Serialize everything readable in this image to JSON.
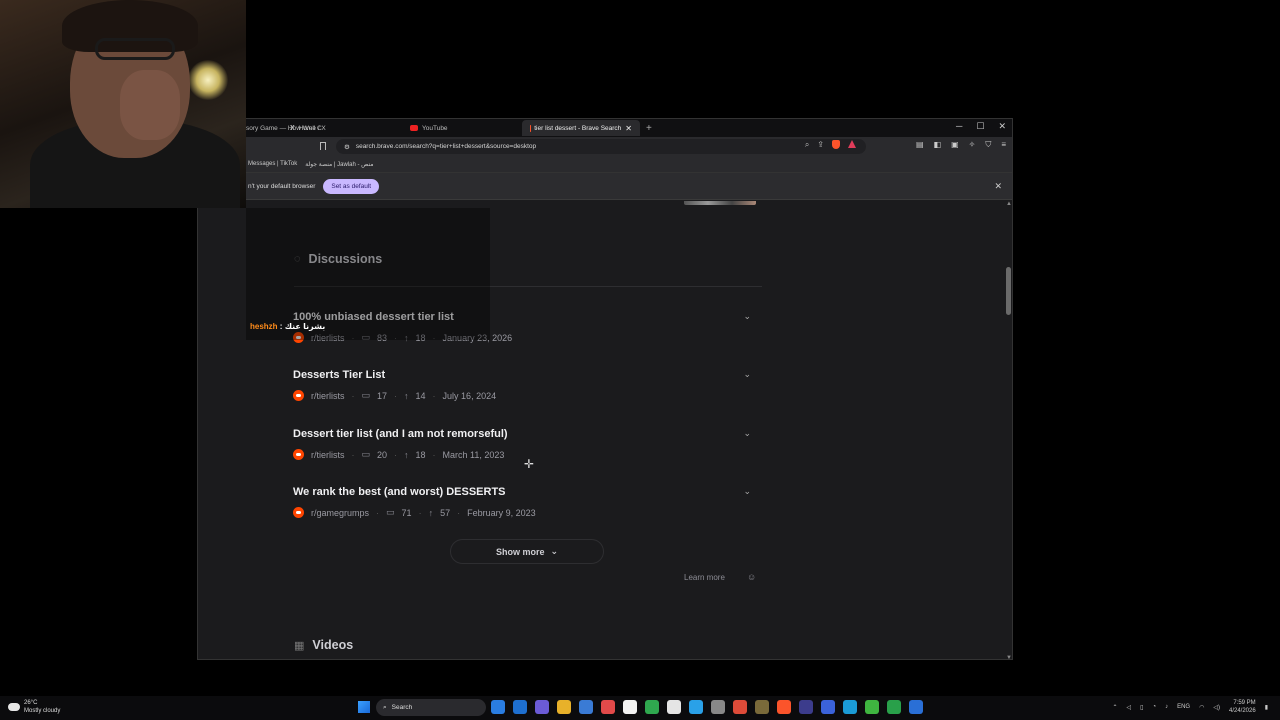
{
  "chat_overlay": {
    "user": "heshzh",
    "separator": ":",
    "message": "بشرنا عنك"
  },
  "browser": {
    "tabs": [
      {
        "label": "sory Game — How Well C"
      },
      {
        "label": "Home / X"
      },
      {
        "label": "YouTube"
      },
      {
        "label": "tier list dessert - Brave Search",
        "active": true
      }
    ],
    "new_tab": "+",
    "url": "search.brave.com/search?q=tier+list+dessert&source=desktop",
    "bookmarks": [
      "Messages | TikTok",
      "منصة جولة | Jawlah - منص"
    ],
    "infobar": {
      "text": "n't your default browser",
      "button": "Set as default"
    }
  },
  "page": {
    "discussions_heading": "Discussions",
    "discussions": [
      {
        "title": "100% unbiased dessert tier list",
        "subreddit": "r/tierlists",
        "comments": "83",
        "upvotes": "18",
        "date": "January 23, 2026"
      },
      {
        "title": "Desserts Tier List",
        "subreddit": "r/tierlists",
        "comments": "17",
        "upvotes": "14",
        "date": "July 16, 2024"
      },
      {
        "title": "Dessert tier list (and I am not remorseful)",
        "subreddit": "r/tierlists",
        "comments": "20",
        "upvotes": "18",
        "date": "March 11, 2023"
      },
      {
        "title": "We rank the best (and worst) DESSERTS",
        "subreddit": "r/gamegrumps",
        "comments": "71",
        "upvotes": "57",
        "date": "February 9, 2023"
      }
    ],
    "show_more": "Show more",
    "learn_more": "Learn more",
    "videos_heading": "Videos"
  },
  "taskbar": {
    "weather": {
      "temp": "26°C",
      "condition": "Mostly cloudy"
    },
    "search_label": "Search",
    "language": "ENG",
    "time": "7:59 PM",
    "date": "4/24/2026",
    "app_colors": [
      "#2a7de1",
      "#1e6fcf",
      "#6b5bd6",
      "#e8b12a",
      "#3a7bd5",
      "#e24a4a",
      "#f2f2f2",
      "#2fa84f",
      "#e5e5e5",
      "#2aa1e8",
      "#888888",
      "#dd4b39",
      "#7a6a3a",
      "#fb542b",
      "#3c3c8c",
      "#3b62d9",
      "#1b9bd6",
      "#3fb540",
      "#29a04a",
      "#2a6fd6"
    ]
  },
  "colors": {
    "brave_accent": "#fb542b",
    "reddit": "#ff4500",
    "set_default_bg": "#c9b8ff",
    "chat_user": "#ff8c1a"
  }
}
